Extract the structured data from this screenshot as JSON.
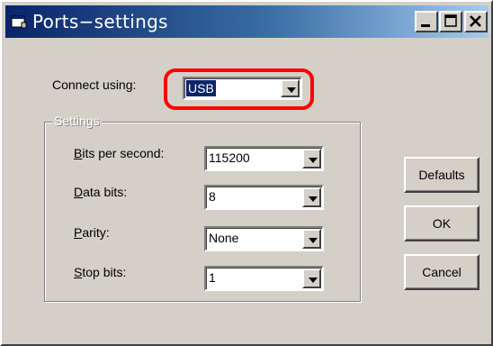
{
  "window": {
    "title": "Ports−settings"
  },
  "connect": {
    "label": "Connect using:",
    "value": "USB"
  },
  "settings": {
    "legend": "Settings",
    "fields": [
      {
        "accel": "B",
        "rest": "its per second:",
        "value": "115200"
      },
      {
        "accel": "D",
        "rest": "ata bits:",
        "value": "8"
      },
      {
        "accel": "P",
        "rest": "arity:",
        "value": "None"
      },
      {
        "accel": "S",
        "rest": "top bits:",
        "value": "1"
      }
    ]
  },
  "buttons": {
    "defaults": "Defaults",
    "ok": "OK",
    "cancel": "Cancel"
  },
  "colors": {
    "face": "#d4d0c8",
    "title_start": "#0a246a",
    "title_end": "#a6caf0",
    "highlight": "#ff0000"
  },
  "icons": [
    "window-icon",
    "minimize-icon",
    "maximize-icon",
    "close-icon",
    "dropdown-arrow-icon"
  ]
}
